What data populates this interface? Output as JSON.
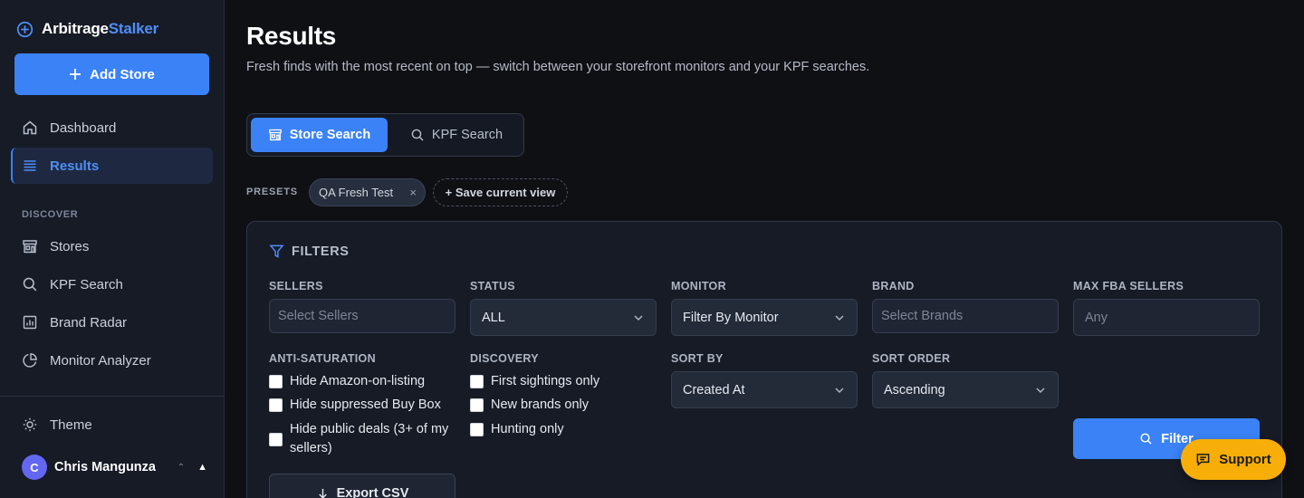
{
  "brand": {
    "name_part1": "Arbitrage",
    "name_part2": "Stalker"
  },
  "sidebar": {
    "add_store_label": "Add Store",
    "items": [
      {
        "label": "Dashboard",
        "icon": "home-icon"
      },
      {
        "label": "Results",
        "icon": "list-icon",
        "active": true
      }
    ],
    "section_label": "DISCOVER",
    "discover_items": [
      {
        "label": "Stores",
        "icon": "store-icon"
      },
      {
        "label": "KPF Search",
        "icon": "search-icon"
      },
      {
        "label": "Brand Radar",
        "icon": "bar-chart-icon"
      },
      {
        "label": "Monitor Analyzer",
        "icon": "pie-chart-icon"
      }
    ],
    "theme_label": "Theme",
    "user": {
      "initial": "C",
      "name": "Chris Mangunza"
    }
  },
  "header": {
    "title": "Results",
    "subtitle": "Fresh finds with the most recent on top — switch between your storefront monitors and your KPF searches."
  },
  "tabs": [
    {
      "label": "Store Search",
      "active": true
    },
    {
      "label": "KPF Search",
      "active": false
    }
  ],
  "presets": {
    "label": "PRESETS",
    "chips": [
      {
        "label": "QA Fresh Test"
      }
    ],
    "save_label": "+ Save current view"
  },
  "filters": {
    "title": "FILTERS",
    "sellers": {
      "label": "SELLERS",
      "placeholder": "Select Sellers"
    },
    "status": {
      "label": "STATUS",
      "value": "ALL"
    },
    "monitor": {
      "label": "MONITOR",
      "value": "Filter By Monitor"
    },
    "brand": {
      "label": "BRAND",
      "placeholder": "Select Brands"
    },
    "max_fba": {
      "label": "MAX FBA SELLERS",
      "placeholder": "Any"
    },
    "anti_saturation": {
      "label": "ANTI-SATURATION",
      "options": [
        "Hide Amazon-on-listing",
        "Hide suppressed Buy Box",
        "Hide public deals (3+ of my sellers)"
      ]
    },
    "discovery": {
      "label": "DISCOVERY",
      "options": [
        "First sightings only",
        "New brands only",
        "Hunting only"
      ]
    },
    "sort_by": {
      "label": "SORT BY",
      "value": "Created At"
    },
    "sort_order": {
      "label": "SORT ORDER",
      "value": "Ascending"
    },
    "filter_button": "Filter",
    "export_button": "Export CSV"
  },
  "support": {
    "label": "Support"
  },
  "colors": {
    "accent": "#3b82f6",
    "support": "#f8ae08",
    "background": "#0f1014",
    "sidebar": "#161b26"
  }
}
